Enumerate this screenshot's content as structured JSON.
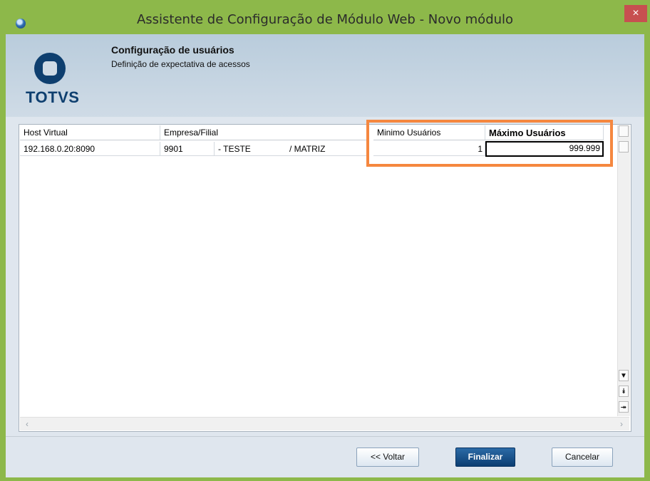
{
  "window": {
    "title": "Assistente de Configuração de Módulo Web - Novo módulo",
    "close_label": "×"
  },
  "header": {
    "logo_text": "TOTVS",
    "title": "Configuração de usuários",
    "subtitle": "Definição de expectativa de acessos"
  },
  "table": {
    "columns": [
      "Host Virtual",
      "Empresa/Filial",
      "Minimo Usuários",
      "Máximo Usuários"
    ],
    "rows": [
      {
        "host": "192.168.0.20:8090",
        "empresa_codigo": "9901",
        "empresa_nome": "- TESTE",
        "filial": "/ MATRIZ",
        "minimo": "1",
        "maximo": "999.999"
      }
    ]
  },
  "scrollbar": {
    "down_icon": "▼",
    "page_down_icon": "⯯",
    "end_icon": "⯮",
    "left_icon": "‹",
    "right_icon": "›"
  },
  "footer": {
    "back_label": "<< Voltar",
    "finish_label": "Finalizar",
    "cancel_label": "Cancelar"
  },
  "colors": {
    "titlebar": "#8db84a",
    "highlight": "#f5873f",
    "primary_button": "#0c3e72",
    "logo": "#0e3f6f"
  }
}
